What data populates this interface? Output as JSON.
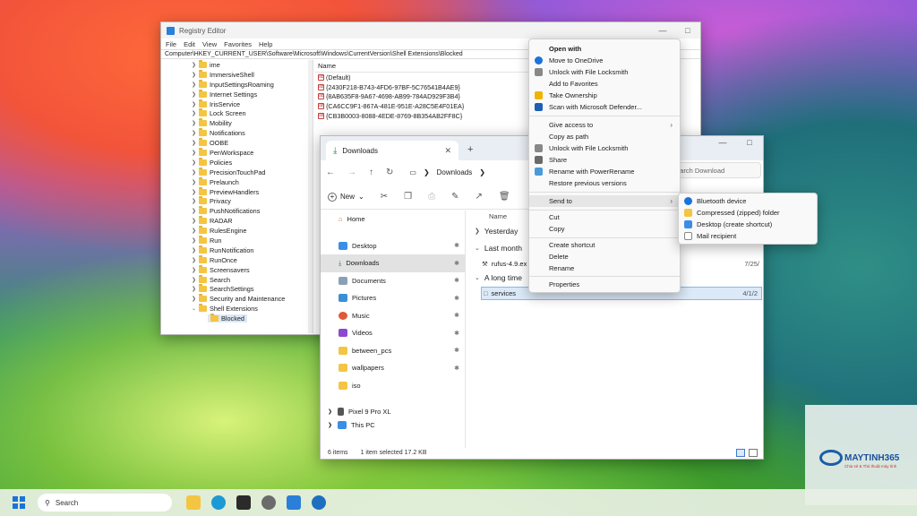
{
  "registry": {
    "title": "Registry Editor",
    "menu": [
      "File",
      "Edit",
      "View",
      "Favorites",
      "Help"
    ],
    "address": "Computer\\HKEY_CURRENT_USER\\Software\\Microsoft\\Windows\\CurrentVersion\\Shell Extensions\\Blocked",
    "tree": [
      "ime",
      "ImmersiveShell",
      "InputSettingsRoaming",
      "Internet Settings",
      "IrisService",
      "Lock Screen",
      "Mobility",
      "Notifications",
      "OOBE",
      "PenWorkspace",
      "Policies",
      "PrecisionTouchPad",
      "Prelaunch",
      "PreviewHandlers",
      "Privacy",
      "PushNotifications",
      "RADAR",
      "RulesEngine",
      "Run",
      "RunNotification",
      "RunOnce",
      "Screensavers",
      "Search",
      "SearchSettings",
      "Security and Maintenance",
      "Shell Extensions"
    ],
    "tree_selected": "Blocked",
    "list_header": "Name",
    "values": [
      "(Default)",
      "{2430F218-B743-4FD6-97BF-5C76541B4AE9}",
      "{8AB635F8-9A67-4698-AB99-784AD929F3B4}",
      "{CA6CC9F1-867A-481E-951E-A28C5E4F01EA}",
      "{CB3B0003-8088-4EDE-8769-8B354AB2FF8C}"
    ]
  },
  "explorer": {
    "tab": "Downloads",
    "breadcrumb": "Downloads",
    "search_placeholder": "earch Download",
    "new_label": "New",
    "nav": {
      "home": "Home",
      "pinned": [
        "Desktop",
        "Downloads",
        "Documents",
        "Pictures",
        "Music",
        "Videos",
        "between_pcs",
        "wallpapers",
        "iso"
      ],
      "device": "Pixel 9 Pro XL",
      "thispc": "This PC"
    },
    "column_name": "Name",
    "groups": [
      "Yesterday",
      "Last month",
      "A long time"
    ],
    "files": [
      {
        "name": "rufus-4.9.ex",
        "date": "7/25/"
      },
      {
        "name": "services",
        "date": "4/1/2"
      }
    ],
    "status_items": "6 items",
    "status_selected": "1 item selected  17.2 KB"
  },
  "context_menu": {
    "items": [
      "Open with",
      "Move to OneDrive",
      "Unlock with File Locksmith",
      "Add to Favorites",
      "Take Ownership",
      "Scan with Microsoft Defender...",
      "Give access to",
      "Copy as path",
      "Unlock with File Locksmith",
      "Share",
      "Rename with PowerRename",
      "Restore previous versions",
      "Send to",
      "Cut",
      "Copy",
      "Create shortcut",
      "Delete",
      "Rename",
      "Properties"
    ]
  },
  "send_to": {
    "items": [
      "Bluetooth device",
      "Compressed (zipped) folder",
      "Desktop (create shortcut)",
      "Mail recipient"
    ]
  },
  "taskbar": {
    "search": "Search"
  },
  "watermark": {
    "name": "MAYTINH365",
    "tagline": "Chia sẻ & Thủ thuật máy tính"
  },
  "colors": {
    "accent": "#1a73d9",
    "selection": "#dbe9f8",
    "folder": "#f4c542"
  }
}
